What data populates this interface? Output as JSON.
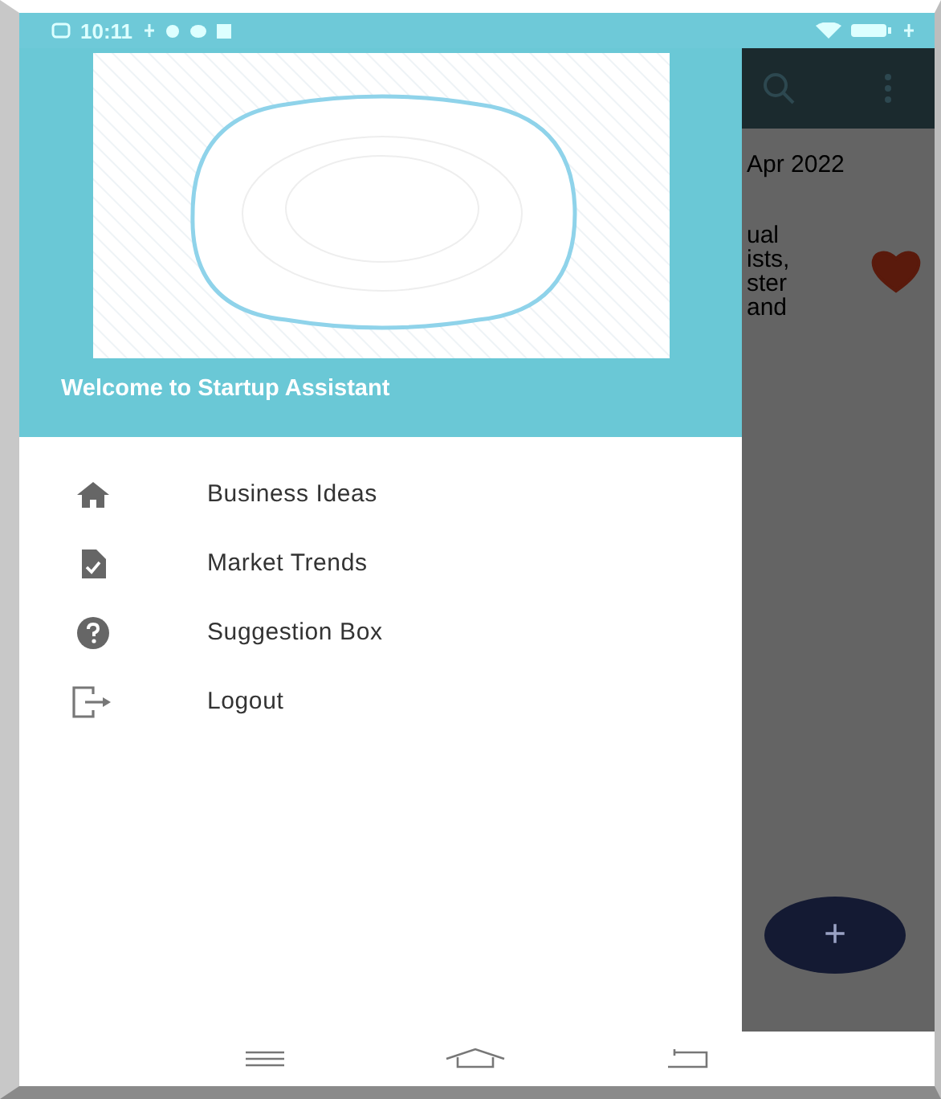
{
  "status_bar": {
    "time": "10:11"
  },
  "drawer": {
    "header_title": "Welcome to Startup Assistant",
    "items": [
      {
        "label": "Business Ideas",
        "kind": "home"
      },
      {
        "label": "Market Trends",
        "kind": "report"
      },
      {
        "label": "Suggestion Box",
        "kind": "help"
      },
      {
        "label": "Logout",
        "kind": "logout"
      }
    ]
  },
  "background_screen": {
    "date": "Apr 2022",
    "text_lines": [
      "ual",
      "ists,",
      "ster",
      "and"
    ],
    "favorite": true,
    "fab_label": "+"
  }
}
